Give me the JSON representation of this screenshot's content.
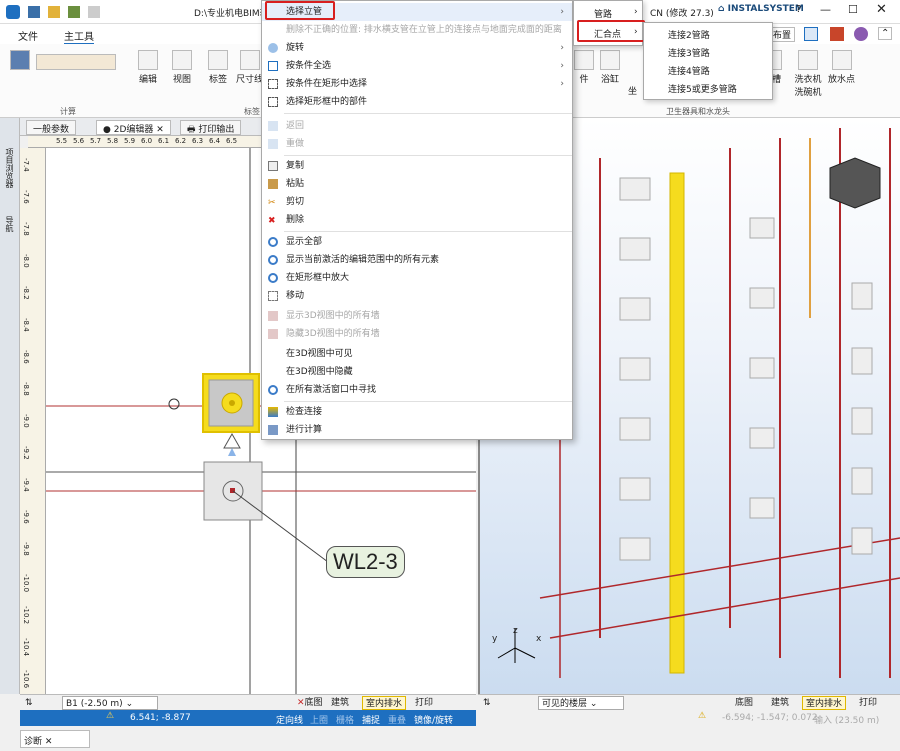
{
  "titlebar": {
    "path": "D:\\专业机电BIM软",
    "cn_suffix": "CN (修改 27.3)",
    "brand": "INSTALSYSTEM"
  },
  "menubar": {
    "file": "文件",
    "main_tools": "主工具",
    "right_label": "口布置"
  },
  "ribbon": {
    "edit": "编辑",
    "view": "视图",
    "label": "标签",
    "dimension": "尺寸线",
    "calc_group": "计算",
    "label_group": "标签",
    "bathtub": "浴缸",
    "sink": "水槽",
    "washer": "洗衣机\n洗碗机",
    "drain_point": "放水点",
    "fixtures_group": "卫生器具和水龙头",
    "cut": "件",
    "coord": "坐"
  },
  "doctabs": {
    "general": "一般参数",
    "editor2d": "● 2D编辑器",
    "print_out": "打印输出"
  },
  "ruler_h_ticks": [
    "5.5",
    "5.6",
    "5.7",
    "5.8",
    "5.9",
    "6.0",
    "6.1",
    "6.2",
    "6.3",
    "6.4",
    "6.5"
  ],
  "ruler_v_ticks": [
    "-7.4",
    "-7.6",
    "-7.8",
    "-8.0",
    "-8.2",
    "-8.4",
    "-8.6",
    "-8.8",
    "-9.0",
    "-9.2",
    "-9.4",
    "-9.6",
    "-9.8",
    "-10.0",
    "-10.2",
    "-10.4",
    "-10.6"
  ],
  "canvas": {
    "tag_label": "WL2-3"
  },
  "sidebar_labels": {
    "project_browser": "项目浏览器",
    "navigator": "导航"
  },
  "context_menu": {
    "select_riser": "选择立管",
    "delete_wrong": "删除不正确的位置: 排水横支管在立管上的连接点与地面完成面的距离",
    "rotate": "旋转",
    "select_by_condition": "按条件全选",
    "select_in_rect_by_condition": "按条件在矩形中选择",
    "select_parts_in_rect": "选择矩形框中的部件",
    "undo": "返回",
    "redo": "重做",
    "copy": "复制",
    "paste": "粘贴",
    "cut": "剪切",
    "delete": "删除",
    "show_all": "显示全部",
    "show_active_elements": "显示当前激活的编辑范围中的所有元素",
    "zoom_in_rect": "在矩形框中放大",
    "move": "移动",
    "show_3d_walls": "显示3D视图中的所有墙",
    "hide_3d_walls": "隐藏3D视图中的所有墙",
    "visible_in_3d": "在3D视图中可见",
    "hide_in_3d": "在3D视图中隐藏",
    "find_in_windows": "在所有激活窗口中寻找",
    "check_connection": "检查连接",
    "run_calculation": "进行计算"
  },
  "submenu1": {
    "pipes": "管路",
    "junction": "汇合点"
  },
  "submenu2": [
    "连接2管路",
    "连接3管路",
    "连接4管路",
    "连接5或更多管路"
  ],
  "bottom_left": {
    "floor": "B1 (-2.50 m)",
    "floor_plan": "底图",
    "building": "建筑",
    "indoor_drain": "室内排水",
    "print": "打印"
  },
  "bottom_right": {
    "visible_floors": "可见的楼层",
    "floor_plan": "底图",
    "building": "建筑",
    "indoor_drain": "室内排水",
    "print": "打印"
  },
  "status_2d": {
    "coords": "6.541; -8.877",
    "positioning": "定向线",
    "top": "上圈",
    "grid": "栅格",
    "snap": "捕捉",
    "overlap": "重叠",
    "mirror": "镜像/旋转"
  },
  "status_3d": {
    "coords": "-6.594; -1.547; 0.072",
    "input": "输入 (23.50 m)"
  },
  "diagnose_tab": "诊断",
  "axes_3d": {
    "x": "x",
    "y": "y",
    "z": "z"
  },
  "colors": {
    "accent_blue": "#1e6fc0",
    "highlight_red": "#d81f1f",
    "riser_yellow": "#f5dc1e",
    "pipe_red": "#b0272b"
  }
}
